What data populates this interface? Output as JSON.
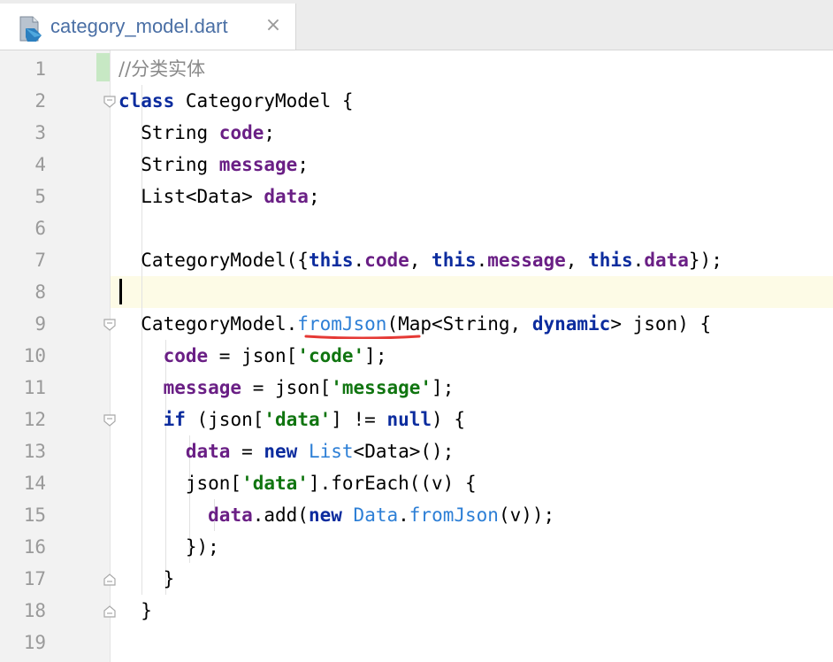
{
  "tab": {
    "file_name": "category_model.dart",
    "close_glyph": "×",
    "icon": "dart-file-icon"
  },
  "editor": {
    "current_line": 8,
    "line_numbers": [
      "1",
      "2",
      "3",
      "4",
      "5",
      "6",
      "7",
      "8",
      "9",
      "10",
      "11",
      "12",
      "13",
      "14",
      "15",
      "16",
      "17",
      "18",
      "19"
    ],
    "lines": [
      [
        {
          "t": "//分类实体",
          "c": "cmt"
        }
      ],
      [
        {
          "t": "class",
          "c": "kw"
        },
        {
          "t": " CategoryModel {"
        }
      ],
      [
        {
          "t": "  String "
        },
        {
          "t": "code",
          "c": "fld"
        },
        {
          "t": ";"
        }
      ],
      [
        {
          "t": "  String "
        },
        {
          "t": "message",
          "c": "fld"
        },
        {
          "t": ";"
        }
      ],
      [
        {
          "t": "  List<Data> "
        },
        {
          "t": "data",
          "c": "fld"
        },
        {
          "t": ";"
        }
      ],
      [],
      [
        {
          "t": "  CategoryModel({"
        },
        {
          "t": "this",
          "c": "kw"
        },
        {
          "t": "."
        },
        {
          "t": "code",
          "c": "fld"
        },
        {
          "t": ", "
        },
        {
          "t": "this",
          "c": "kw"
        },
        {
          "t": "."
        },
        {
          "t": "message",
          "c": "fld"
        },
        {
          "t": ", "
        },
        {
          "t": "this",
          "c": "kw"
        },
        {
          "t": "."
        },
        {
          "t": "data",
          "c": "fld"
        },
        {
          "t": "});"
        }
      ],
      [],
      [
        {
          "t": "  CategoryModel."
        },
        {
          "t": "fromJson",
          "c": "fn"
        },
        {
          "t": "(Map<String, "
        },
        {
          "t": "dynamic",
          "c": "kw"
        },
        {
          "t": "> json) {"
        }
      ],
      [
        {
          "t": "    "
        },
        {
          "t": "code",
          "c": "fld"
        },
        {
          "t": " = json["
        },
        {
          "t": "'code'",
          "c": "str"
        },
        {
          "t": "];"
        }
      ],
      [
        {
          "t": "    "
        },
        {
          "t": "message",
          "c": "fld"
        },
        {
          "t": " = json["
        },
        {
          "t": "'message'",
          "c": "str"
        },
        {
          "t": "];"
        }
      ],
      [
        {
          "t": "    "
        },
        {
          "t": "if",
          "c": "kw"
        },
        {
          "t": " (json["
        },
        {
          "t": "'data'",
          "c": "str"
        },
        {
          "t": "] != "
        },
        {
          "t": "null",
          "c": "kw"
        },
        {
          "t": ") {"
        }
      ],
      [
        {
          "t": "      "
        },
        {
          "t": "data",
          "c": "fld"
        },
        {
          "t": " = "
        },
        {
          "t": "new",
          "c": "kw"
        },
        {
          "t": " "
        },
        {
          "t": "List",
          "c": "fn"
        },
        {
          "t": "<Data>();"
        }
      ],
      [
        {
          "t": "      json["
        },
        {
          "t": "'data'",
          "c": "str"
        },
        {
          "t": "].forEach((v) {"
        }
      ],
      [
        {
          "t": "        "
        },
        {
          "t": "data",
          "c": "fld"
        },
        {
          "t": ".add("
        },
        {
          "t": "new",
          "c": "kw"
        },
        {
          "t": " "
        },
        {
          "t": "Data",
          "c": "fn"
        },
        {
          "t": "."
        },
        {
          "t": "fromJson",
          "c": "fn"
        },
        {
          "t": "(v));"
        }
      ],
      [
        {
          "t": "      });"
        }
      ],
      [
        {
          "t": "    }"
        }
      ],
      [
        {
          "t": "  }"
        }
      ],
      []
    ]
  },
  "colors": {
    "keyword": "#0c2c9e",
    "field": "#6a1f85",
    "string": "#107510",
    "comment": "#8a8a8a",
    "function": "#2d7fd6",
    "squiggle": "#e53935",
    "current_line_bg": "#fdfbe6"
  }
}
